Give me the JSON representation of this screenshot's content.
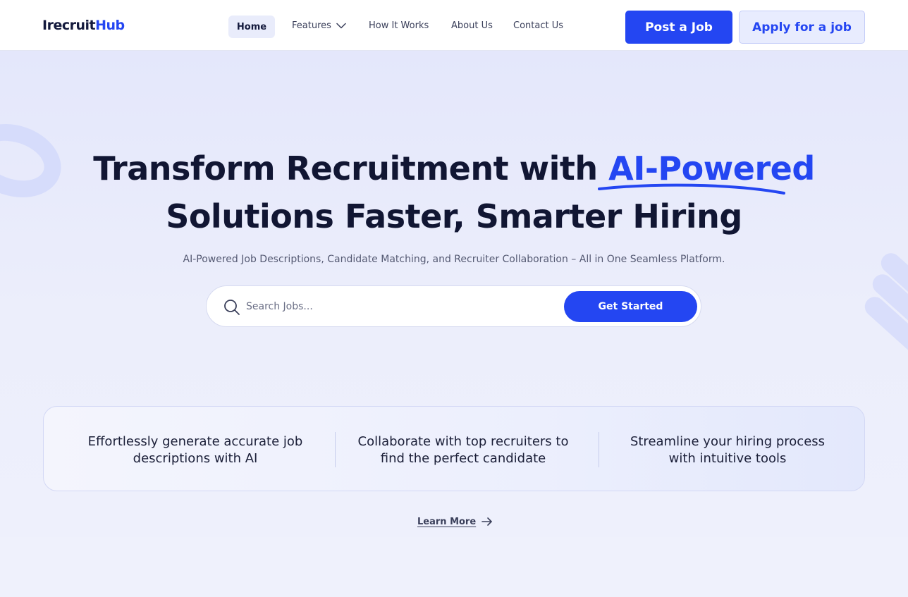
{
  "header": {
    "logo_primary": "Irecruit",
    "logo_accent": "Hub",
    "nav": {
      "home": "Home",
      "features": "Features",
      "how_it_works": "How It Works",
      "about": "About Us",
      "contact": "Contact Us"
    },
    "post_job_label": "Post a Job",
    "apply_job_label": "Apply for a job"
  },
  "hero": {
    "headline_part1": "Transform Recruitment with ",
    "headline_highlight": "AI-Powered",
    "headline_line2": "Solutions Faster, Smarter Hiring",
    "subtitle": "AI-Powered Job Descriptions, Candidate Matching, and Recruiter Collaboration – All in One Seamless Platform.",
    "search": {
      "placeholder": "Search Jobs...",
      "value": "",
      "button_label": "Get Started"
    }
  },
  "features": [
    {
      "line1": "Effortlessly generate accurate job",
      "line2": "descriptions with AI"
    },
    {
      "line1": "Collaborate with top recruiters to",
      "line2": "find the perfect candidate"
    },
    {
      "line1": "Streamline your hiring process",
      "line2": "with intuitive tools"
    }
  ],
  "learn_more_label": "Learn More",
  "icons": {
    "search": "search-icon",
    "features_dropdown": "chevron-down-icon",
    "learn_more": "arrow-right-icon"
  },
  "colors": {
    "accent": "#2446f2",
    "heading": "#111633",
    "background": "#eef0fb"
  }
}
